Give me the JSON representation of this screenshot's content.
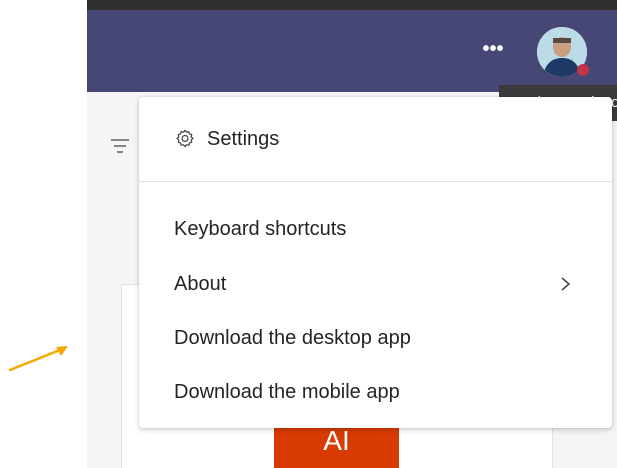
{
  "topbar": {
    "more_label": "•••",
    "avatar_icon": "user-avatar",
    "status_color": "#c4314b",
    "tooltip": "Settings and more"
  },
  "menu": {
    "settings_label": "Settings",
    "items": [
      {
        "label": "Keyboard shortcuts"
      },
      {
        "label": "About"
      },
      {
        "label": "Download the desktop app"
      },
      {
        "label": "Download the mobile app"
      }
    ]
  },
  "background": {
    "tile_text": "AI"
  },
  "annotation": {
    "arrow_color": "#f5a800"
  },
  "colors": {
    "brand": "#464775",
    "tile": "#d83b01"
  }
}
